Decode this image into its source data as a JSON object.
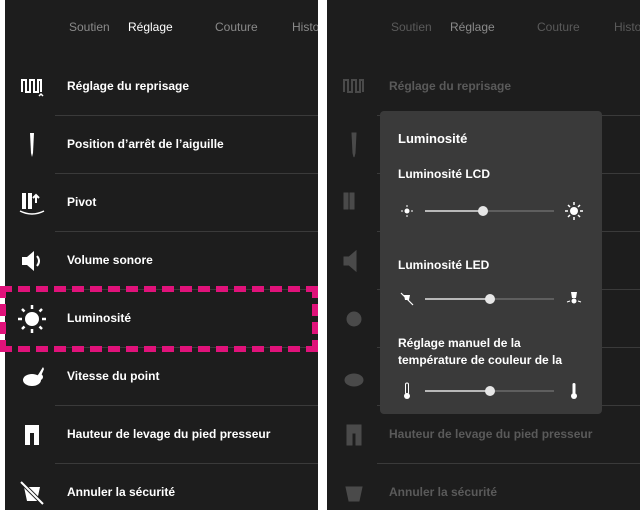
{
  "tabs": [
    "Soutien",
    "Réglage",
    "Couture",
    "Histo"
  ],
  "active_tab": 1,
  "menu": [
    {
      "label": "Réglage du reprisage",
      "icon": "darning-icon"
    },
    {
      "label": "Position d’arrêt de l’aiguille",
      "icon": "needle-icon"
    },
    {
      "label": "Pivot",
      "icon": "pivot-icon"
    },
    {
      "label": "Volume sonore",
      "icon": "speaker-icon"
    },
    {
      "label": "Luminosité",
      "icon": "brightness-icon"
    },
    {
      "label": "Vitesse du point",
      "icon": "rabbit-icon"
    },
    {
      "label": "Hauteur de levage du pied presseur",
      "icon": "presser-foot-icon"
    },
    {
      "label": "Annuler la sécurité",
      "icon": "security-off-icon"
    }
  ],
  "popup": {
    "title": "Luminosité",
    "lcd": {
      "label": "Luminosité LCD",
      "level": 0.45
    },
    "led": {
      "label": "Luminosité LED",
      "level": 0.5
    },
    "color_temp": {
      "label_line1": "Réglage manuel de la",
      "label_line2": "température de couleur de la",
      "level": 0.5
    }
  },
  "colors": {
    "background": "#1d1d1d",
    "popup": "#3a3a3a",
    "highlight": "#e0127a",
    "text": "#ffffff",
    "muted_text": "#8a8a8a"
  }
}
